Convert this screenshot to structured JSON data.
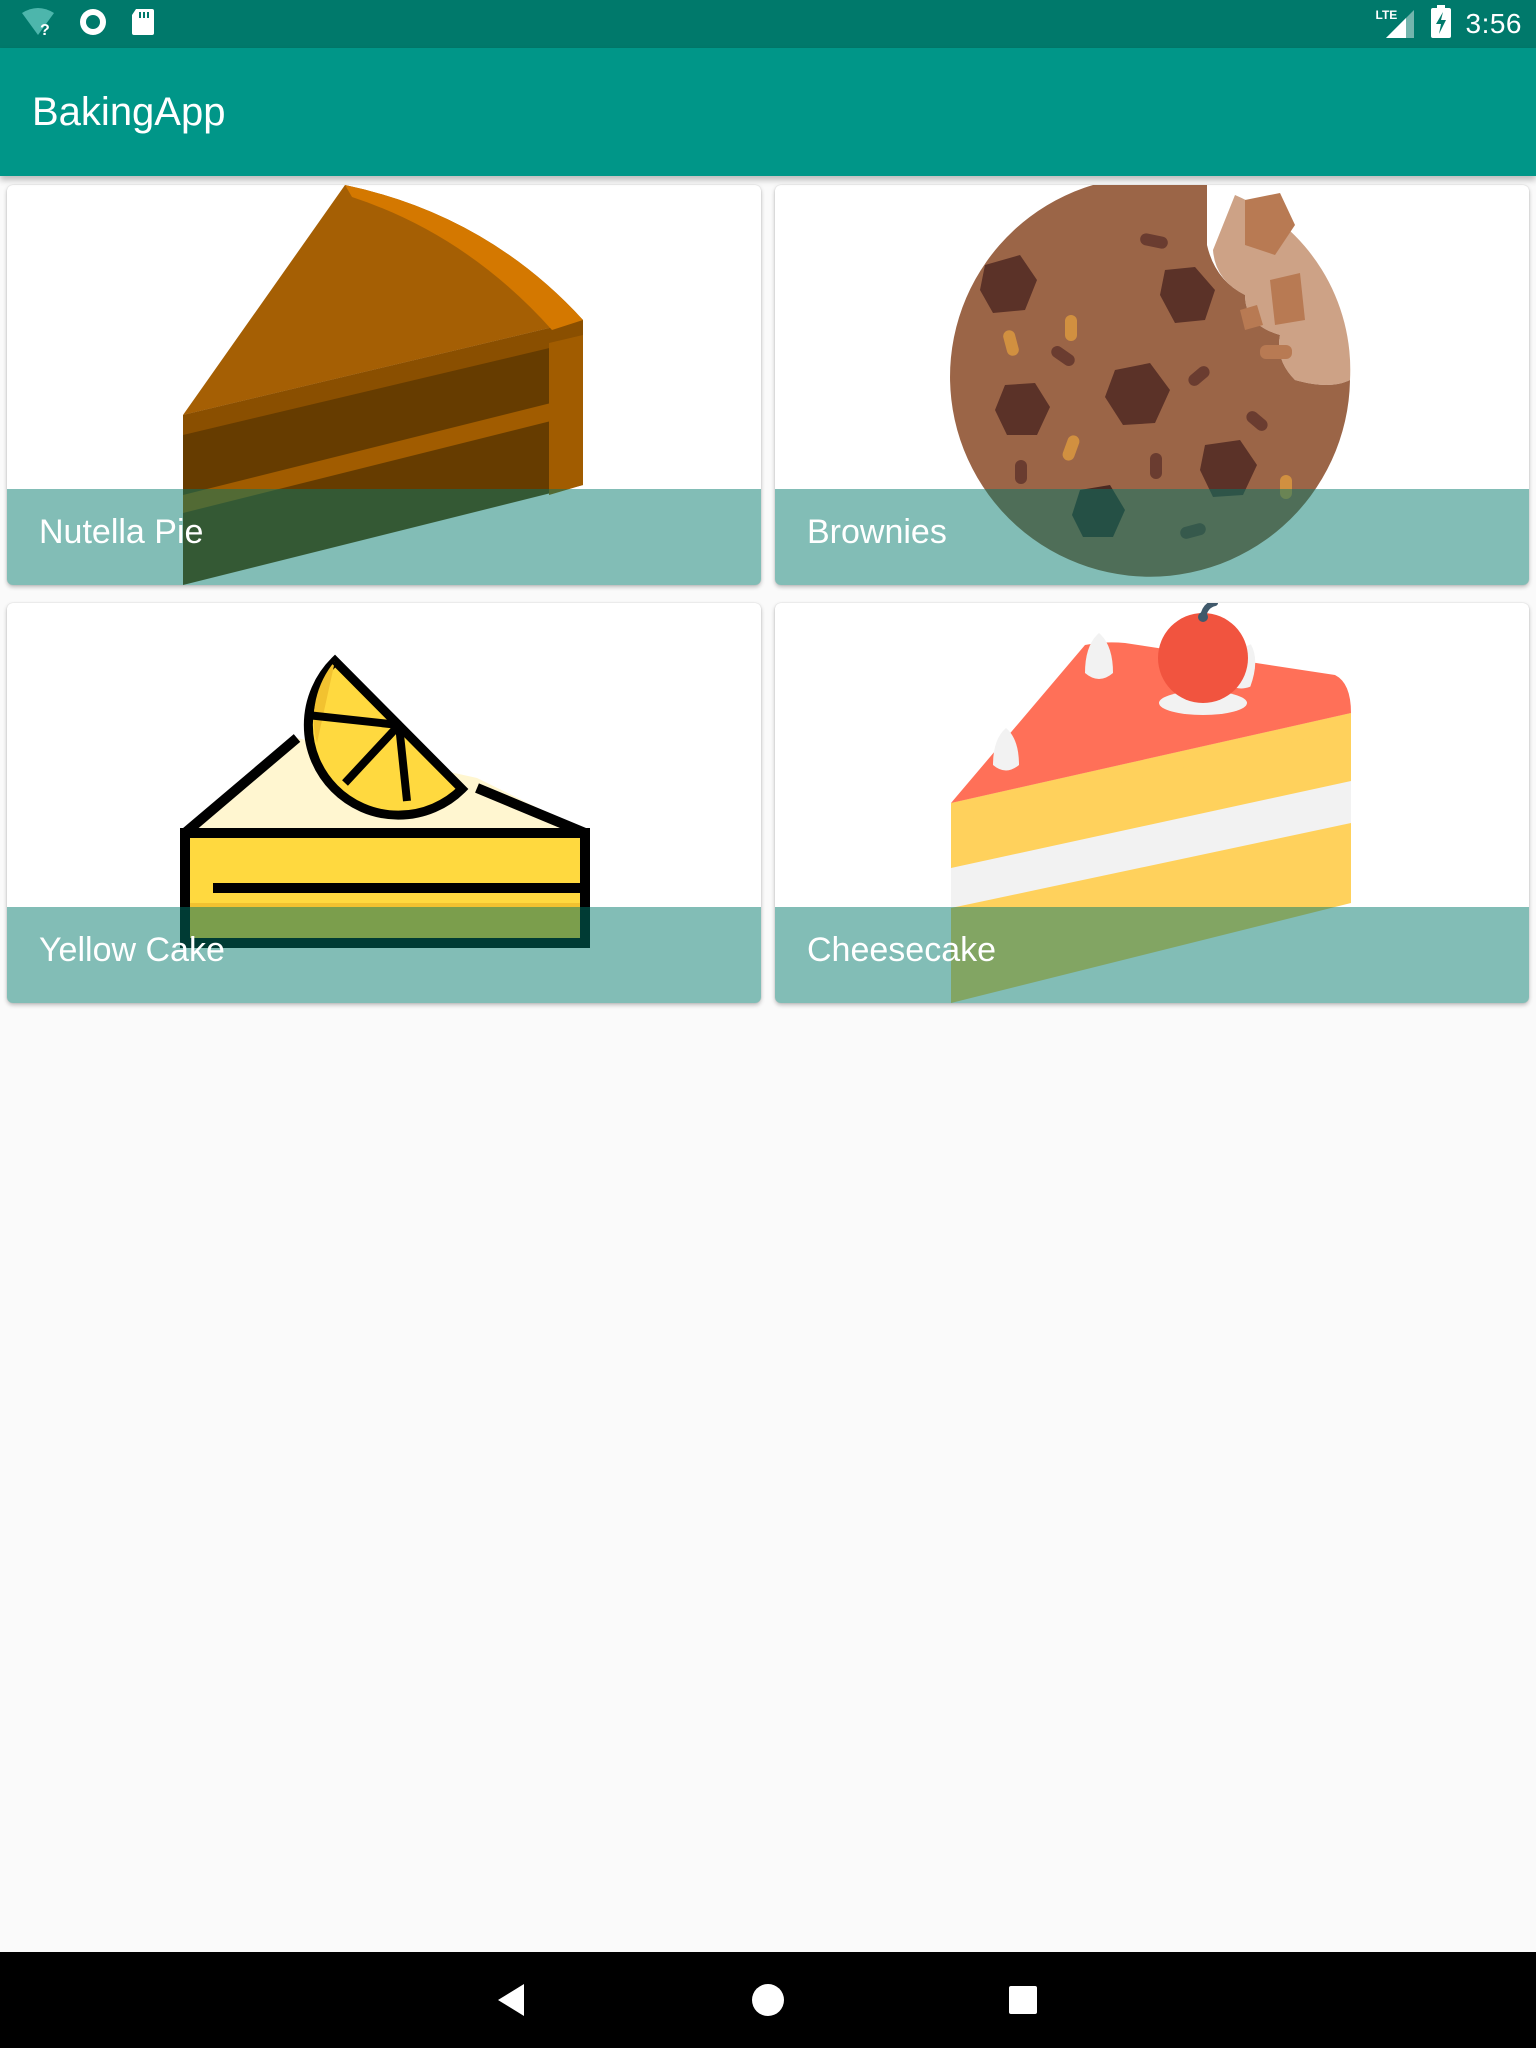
{
  "status_bar": {
    "time": "3:56",
    "network_label": "LTE",
    "icons": [
      "wifi-unknown-icon",
      "sync-circle-icon",
      "sd-card-icon",
      "lte-signal-icon",
      "battery-charging-icon"
    ]
  },
  "app_bar": {
    "title": "BakingApp"
  },
  "recipes": [
    {
      "name": "Nutella Pie",
      "icon": "pie-slice-icon"
    },
    {
      "name": "Brownies",
      "icon": "cookie-icon"
    },
    {
      "name": "Yellow Cake",
      "icon": "lemon-cake-icon"
    },
    {
      "name": "Cheesecake",
      "icon": "cherry-cake-icon"
    }
  ],
  "colors": {
    "status_bar": "#00796b",
    "app_bar": "#009688",
    "label_overlay": "rgba(0,121,107,0.49)",
    "background": "#fafafa"
  },
  "nav_bar": {
    "icons": [
      "back-icon",
      "home-icon",
      "recents-icon"
    ]
  }
}
